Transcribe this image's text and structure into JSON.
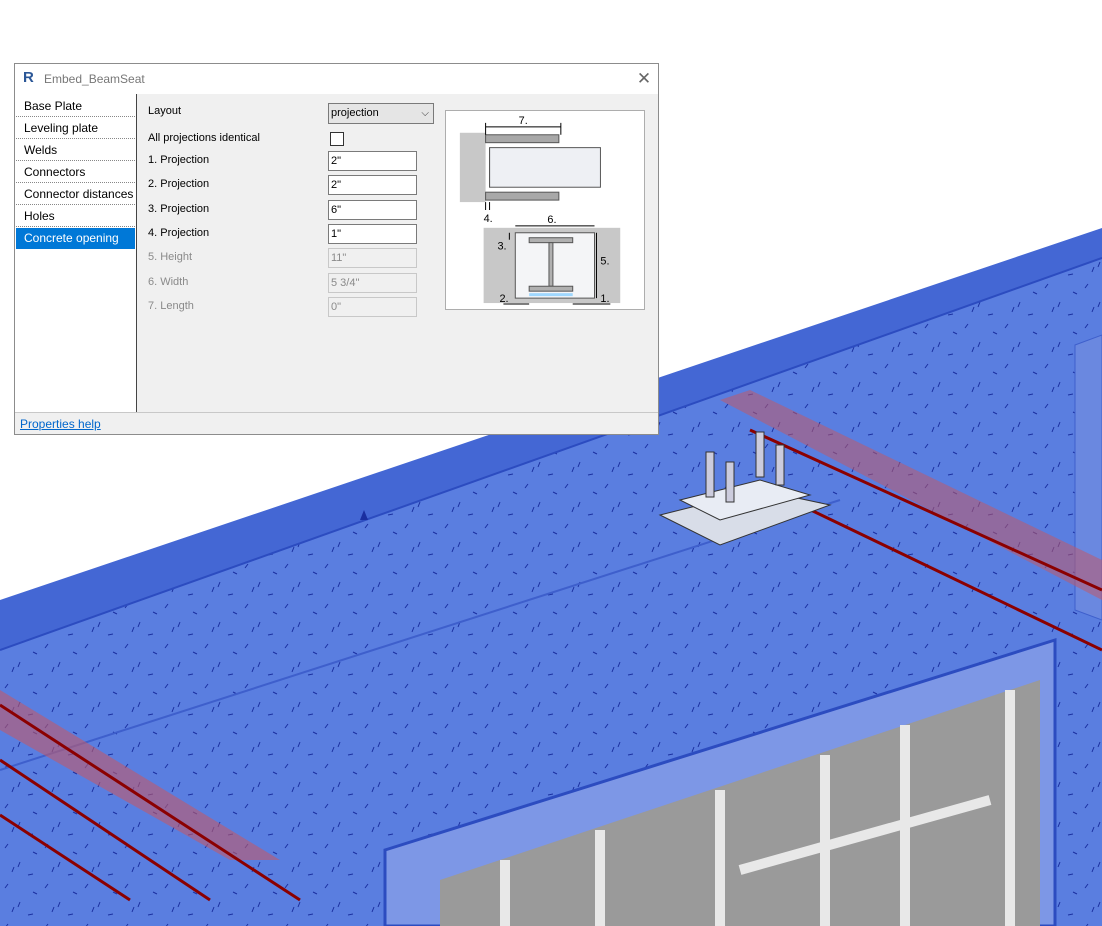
{
  "dialog": {
    "title": "Embed_BeamSeat",
    "app_icon": "R",
    "close_icon": "✕",
    "nav": [
      {
        "label": "Base Plate"
      },
      {
        "label": "Leveling plate"
      },
      {
        "label": "Welds"
      },
      {
        "label": "Connectors"
      },
      {
        "label": "Connector distances"
      },
      {
        "label": "Holes"
      },
      {
        "label": "Concrete opening",
        "selected": true
      }
    ],
    "layout": {
      "label": "Layout",
      "value": "projection"
    },
    "identical": {
      "label": "All projections identical",
      "checked": false
    },
    "fields": [
      {
        "label": "1. Projection",
        "value": "2\"",
        "enabled": true
      },
      {
        "label": "2. Projection",
        "value": "2\"",
        "enabled": true
      },
      {
        "label": "3. Projection",
        "value": "6\"",
        "enabled": true
      },
      {
        "label": "4. Projection",
        "value": "1\"",
        "enabled": true
      },
      {
        "label": "5. Height",
        "value": "11\"",
        "enabled": false
      },
      {
        "label": "6. Width",
        "value": "5 3/4\"",
        "enabled": false
      },
      {
        "label": "7. Length",
        "value": "0\"",
        "enabled": false
      }
    ],
    "diagram_labels": {
      "d1": "1.",
      "d2": "2.",
      "d3": "3.",
      "d4": "4.",
      "d5": "5.",
      "d6": "6.",
      "d7": "7."
    },
    "help_link": "Properties help"
  },
  "colors": {
    "accent": "#0078d7",
    "concrete": "#4a6fd4",
    "beam": "#b22222"
  }
}
